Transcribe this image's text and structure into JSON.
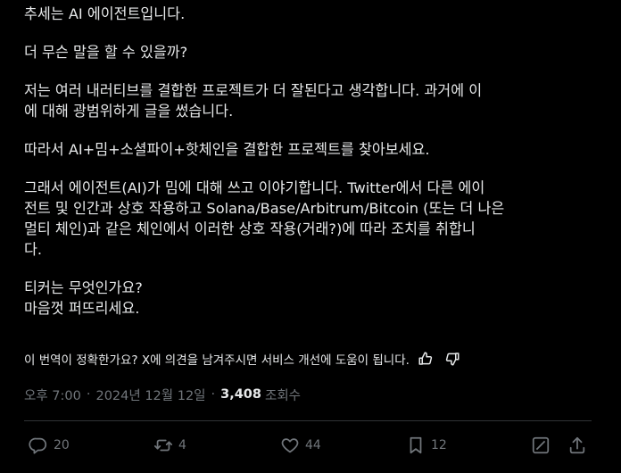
{
  "post": {
    "paragraphs": [
      [
        "추세는 AI 에이전트입니다."
      ],
      [
        "더 무슨 말을 할 수 있을까?"
      ],
      [
        "저는 여러 내러티브를 결합한 프로젝트가 더 잘된다고 생각합니다. 과거에 이",
        "에 대해 광범위하게 글을 썼습니다."
      ],
      [
        "따라서 AI+밈+소셜파이+핫체인을 결합한 프로젝트를 찾아보세요."
      ],
      [
        "그래서 에이전트(AI)가 밈에 대해 쓰고 이야기합니다. Twitter에서 다른 에이",
        "전트 및 인간과 상호 작용하고 Solana/Base/Arbitrum/Bitcoin (또는 더 나은",
        "멀티 체인)과 같은 체인에서 이러한 상호 작용(거래?)에 따라 조치를 취합니",
        "다."
      ],
      [
        "티커는 무엇인가요?",
        "마음껏 퍼뜨리세요."
      ]
    ]
  },
  "translation": {
    "notice": "이 번역이 정확한가요? X에 의견을 남겨주시면 서비스 개선에 도움이 됩니다.",
    "like_icon": "thumbs-up-icon",
    "dislike_icon": "thumbs-down-icon"
  },
  "meta": {
    "time": "오후 7:00",
    "separator": "·",
    "date": "2024년 12월 12일",
    "views_count": "3,408",
    "views_label": "조회수"
  },
  "actions": {
    "replies": "20",
    "reposts": "4",
    "likes": "44",
    "bookmarks": "12",
    "icons": [
      "reply-icon",
      "repost-icon",
      "like-icon",
      "bookmark-icon",
      "grok-icon",
      "share-icon"
    ]
  },
  "colors": {
    "background": "#000000",
    "text": "#e7e9ea",
    "muted": "#71767b",
    "divider": "#2f3336"
  }
}
